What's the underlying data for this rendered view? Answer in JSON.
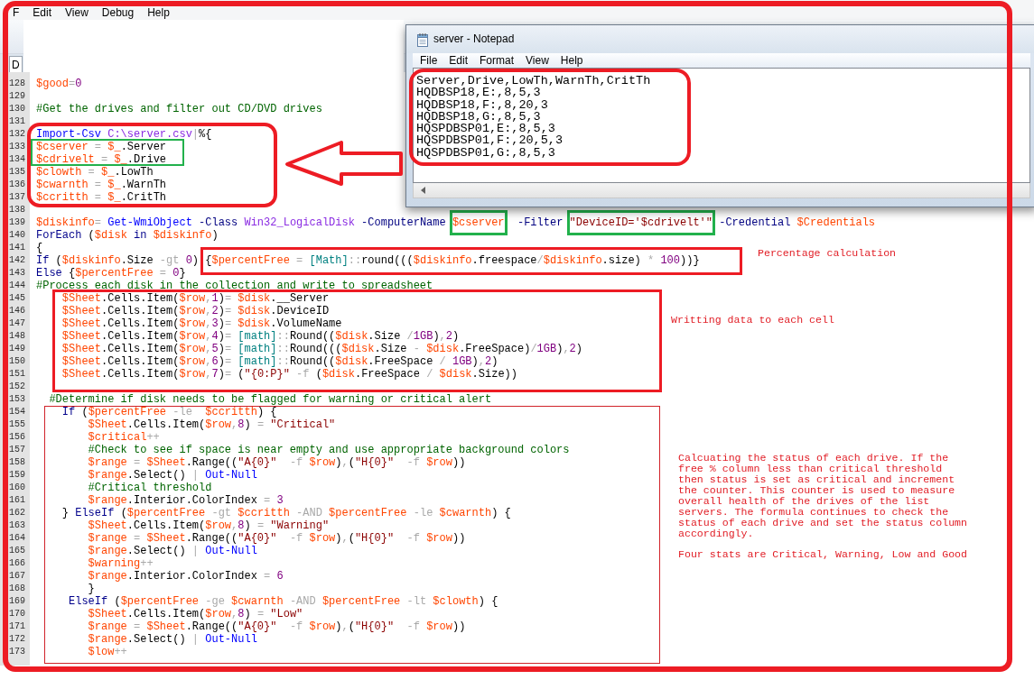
{
  "menu_bar": [
    "F",
    "Edit",
    "View",
    "Debug",
    "Help"
  ],
  "tabs": [
    {
      "label": "D",
      "selected": true
    }
  ],
  "editor": {
    "lines": [
      {
        "number": "128",
        "tokens": [
          {
            "kind": "var",
            "text": "$good"
          },
          {
            "kind": "op",
            "text": "="
          },
          {
            "kind": "num",
            "text": "0"
          }
        ]
      },
      {
        "number": "129"
      },
      {
        "number": "130",
        "tokens": [
          {
            "kind": "comment",
            "text": "#Get the drives and filter out CD/DVD drives"
          }
        ]
      },
      {
        "number": "131"
      },
      {
        "number": "132",
        "tokens": [
          {
            "kind": "cmd",
            "text": "Import-Csv"
          },
          {
            "kind": "arg",
            "text": " C:\\server.csv"
          },
          {
            "kind": "op",
            "text": "|"
          },
          {
            "kind": "text",
            "text": "%{"
          }
        ]
      },
      {
        "number": "133",
        "tokens": [
          {
            "kind": "var",
            "text": "$cserver"
          },
          {
            "kind": "op",
            "text": " = "
          },
          {
            "kind": "var",
            "text": "$_"
          },
          {
            "kind": "text",
            "text": ".Server"
          }
        ]
      },
      {
        "number": "134",
        "tokens": [
          {
            "kind": "var",
            "text": "$cdrivelt"
          },
          {
            "kind": "op",
            "text": " = "
          },
          {
            "kind": "var",
            "text": "$_"
          },
          {
            "kind": "text",
            "text": ".Drive"
          }
        ]
      },
      {
        "number": "135",
        "tokens": [
          {
            "kind": "var",
            "text": "$clowth"
          },
          {
            "kind": "op",
            "text": " = "
          },
          {
            "kind": "var",
            "text": "$_"
          },
          {
            "kind": "text",
            "text": ".LowTh"
          }
        ]
      },
      {
        "number": "136",
        "tokens": [
          {
            "kind": "var",
            "text": "$cwarnth"
          },
          {
            "kind": "op",
            "text": " = "
          },
          {
            "kind": "var",
            "text": "$_"
          },
          {
            "kind": "text",
            "text": ".WarnTh"
          }
        ]
      },
      {
        "number": "137",
        "tokens": [
          {
            "kind": "var",
            "text": "$ccritth"
          },
          {
            "kind": "op",
            "text": " = "
          },
          {
            "kind": "var",
            "text": "$_"
          },
          {
            "kind": "text",
            "text": ".CritTh"
          }
        ]
      },
      {
        "number": "138"
      },
      {
        "number": "139",
        "segments": [
          {
            "highlighted": false,
            "tokens": [
              {
                "kind": "var",
                "text": "$diskinfo"
              },
              {
                "kind": "op",
                "text": "= "
              },
              {
                "kind": "cmd",
                "text": "Get-WmiObject"
              },
              {
                "kind": "param",
                "text": " -Class"
              },
              {
                "kind": "arg",
                "text": " Win32_LogicalDisk"
              },
              {
                "kind": "param",
                "text": " -ComputerName"
              }
            ]
          },
          {
            "highlighted": true,
            "tokens": [
              {
                "kind": "var",
                "text": " $cserver"
              }
            ]
          },
          {
            "highlighted": false,
            "tokens": [
              {
                "kind": "param",
                "text": "  -Filter"
              }
            ]
          },
          {
            "highlighted": true,
            "tokens": [
              {
                "kind": "str",
                "text": " \"DeviceID='$cdrivelt'\""
              }
            ]
          },
          {
            "highlighted": false,
            "tokens": [
              {
                "kind": "param",
                "text": " -Credential"
              },
              {
                "kind": "var",
                "text": " $Credentials"
              }
            ]
          }
        ]
      },
      {
        "number": "140",
        "tokens": [
          {
            "kind": "kw",
            "text": "ForEach"
          },
          {
            "kind": "text",
            "text": " ("
          },
          {
            "kind": "var",
            "text": "$disk"
          },
          {
            "kind": "kw",
            "text": " in"
          },
          {
            "kind": "var",
            "text": " $diskinfo"
          },
          {
            "kind": "text",
            "text": ")"
          }
        ]
      },
      {
        "number": "141",
        "tokens": [
          {
            "kind": "text",
            "text": "{"
          }
        ]
      },
      {
        "number": "142",
        "tokens": [
          {
            "kind": "kw",
            "text": "If"
          },
          {
            "kind": "text",
            "text": " ("
          },
          {
            "kind": "var",
            "text": "$diskinfo"
          },
          {
            "kind": "text",
            "text": ".Size "
          },
          {
            "kind": "op",
            "text": "-gt"
          },
          {
            "kind": "num",
            "text": " 0"
          },
          {
            "kind": "text",
            "text": ") {"
          },
          {
            "kind": "var",
            "text": "$percentFree"
          },
          {
            "kind": "op",
            "text": " = "
          },
          {
            "kind": "type",
            "text": "[Math]"
          },
          {
            "kind": "op",
            "text": "::"
          },
          {
            "kind": "text",
            "text": "round((("
          },
          {
            "kind": "var",
            "text": "$diskinfo"
          },
          {
            "kind": "text",
            "text": ".freespace"
          },
          {
            "kind": "op",
            "text": "/"
          },
          {
            "kind": "var",
            "text": "$diskinfo"
          },
          {
            "kind": "text",
            "text": ".size) "
          },
          {
            "kind": "op",
            "text": "*"
          },
          {
            "kind": "num",
            "text": " 100"
          },
          {
            "kind": "text",
            "text": "))}"
          }
        ]
      },
      {
        "number": "143",
        "tokens": [
          {
            "kind": "kw",
            "text": "Else"
          },
          {
            "kind": "text",
            "text": " {"
          },
          {
            "kind": "var",
            "text": "$percentFree"
          },
          {
            "kind": "op",
            "text": " = "
          },
          {
            "kind": "num",
            "text": "0"
          },
          {
            "kind": "text",
            "text": "}"
          }
        ]
      },
      {
        "number": "144",
        "tokens": [
          {
            "kind": "comment",
            "text": "#Process each disk in the collection and write to spreadsheet"
          }
        ]
      },
      {
        "number": "145",
        "tokens": [
          {
            "kind": "var",
            "text": "    $Sheet"
          },
          {
            "kind": "text",
            "text": ".Cells.Item("
          },
          {
            "kind": "var",
            "text": "$row"
          },
          {
            "kind": "op",
            "text": ","
          },
          {
            "kind": "num",
            "text": "1"
          },
          {
            "kind": "text",
            "text": ")"
          },
          {
            "kind": "op",
            "text": "="
          },
          {
            "kind": "var",
            "text": " $disk"
          },
          {
            "kind": "text",
            "text": ".__Server"
          }
        ]
      },
      {
        "number": "146",
        "tokens": [
          {
            "kind": "var",
            "text": "    $Sheet"
          },
          {
            "kind": "text",
            "text": ".Cells.Item("
          },
          {
            "kind": "var",
            "text": "$row"
          },
          {
            "kind": "op",
            "text": ","
          },
          {
            "kind": "num",
            "text": "2"
          },
          {
            "kind": "text",
            "text": ")"
          },
          {
            "kind": "op",
            "text": "="
          },
          {
            "kind": "var",
            "text": " $disk"
          },
          {
            "kind": "text",
            "text": ".DeviceID"
          }
        ]
      },
      {
        "number": "147",
        "tokens": [
          {
            "kind": "var",
            "text": "    $Sheet"
          },
          {
            "kind": "text",
            "text": ".Cells.Item("
          },
          {
            "kind": "var",
            "text": "$row"
          },
          {
            "kind": "op",
            "text": ","
          },
          {
            "kind": "num",
            "text": "3"
          },
          {
            "kind": "text",
            "text": ")"
          },
          {
            "kind": "op",
            "text": "="
          },
          {
            "kind": "var",
            "text": " $disk"
          },
          {
            "kind": "text",
            "text": ".VolumeName"
          }
        ]
      },
      {
        "number": "148",
        "tokens": [
          {
            "kind": "var",
            "text": "    $Sheet"
          },
          {
            "kind": "text",
            "text": ".Cells.Item("
          },
          {
            "kind": "var",
            "text": "$row"
          },
          {
            "kind": "op",
            "text": ","
          },
          {
            "kind": "num",
            "text": "4"
          },
          {
            "kind": "text",
            "text": ")"
          },
          {
            "kind": "op",
            "text": "="
          },
          {
            "kind": "type",
            "text": " [math]"
          },
          {
            "kind": "op",
            "text": "::"
          },
          {
            "kind": "text",
            "text": "Round(("
          },
          {
            "kind": "var",
            "text": "$disk"
          },
          {
            "kind": "text",
            "text": ".Size "
          },
          {
            "kind": "op",
            "text": "/"
          },
          {
            "kind": "num",
            "text": "1GB"
          },
          {
            "kind": "text",
            "text": ")"
          },
          {
            "kind": "op",
            "text": ","
          },
          {
            "kind": "num",
            "text": "2"
          },
          {
            "kind": "text",
            "text": ")"
          }
        ]
      },
      {
        "number": "149",
        "tokens": [
          {
            "kind": "var",
            "text": "    $Sheet"
          },
          {
            "kind": "text",
            "text": ".Cells.Item("
          },
          {
            "kind": "var",
            "text": "$row"
          },
          {
            "kind": "op",
            "text": ","
          },
          {
            "kind": "num",
            "text": "5"
          },
          {
            "kind": "text",
            "text": ")"
          },
          {
            "kind": "op",
            "text": "="
          },
          {
            "kind": "type",
            "text": " [math]"
          },
          {
            "kind": "op",
            "text": "::"
          },
          {
            "kind": "text",
            "text": "Round((("
          },
          {
            "kind": "var",
            "text": "$disk"
          },
          {
            "kind": "text",
            "text": ".Size "
          },
          {
            "kind": "op",
            "text": "-"
          },
          {
            "kind": "var",
            "text": " $disk"
          },
          {
            "kind": "text",
            "text": ".FreeSpace)"
          },
          {
            "kind": "op",
            "text": "/"
          },
          {
            "kind": "num",
            "text": "1GB"
          },
          {
            "kind": "text",
            "text": ")"
          },
          {
            "kind": "op",
            "text": ","
          },
          {
            "kind": "num",
            "text": "2"
          },
          {
            "kind": "text",
            "text": ")"
          }
        ]
      },
      {
        "number": "150",
        "tokens": [
          {
            "kind": "var",
            "text": "    $Sheet"
          },
          {
            "kind": "text",
            "text": ".Cells.Item("
          },
          {
            "kind": "var",
            "text": "$row"
          },
          {
            "kind": "op",
            "text": ","
          },
          {
            "kind": "num",
            "text": "6"
          },
          {
            "kind": "text",
            "text": ")"
          },
          {
            "kind": "op",
            "text": "="
          },
          {
            "kind": "type",
            "text": " [math]"
          },
          {
            "kind": "op",
            "text": "::"
          },
          {
            "kind": "text",
            "text": "Round(("
          },
          {
            "kind": "var",
            "text": "$disk"
          },
          {
            "kind": "text",
            "text": ".FreeSpace "
          },
          {
            "kind": "op",
            "text": "/"
          },
          {
            "kind": "num",
            "text": " 1GB"
          },
          {
            "kind": "text",
            "text": ")"
          },
          {
            "kind": "op",
            "text": ","
          },
          {
            "kind": "num",
            "text": "2"
          },
          {
            "kind": "text",
            "text": ")"
          }
        ]
      },
      {
        "number": "151",
        "tokens": [
          {
            "kind": "var",
            "text": "    $Sheet"
          },
          {
            "kind": "text",
            "text": ".Cells.Item("
          },
          {
            "kind": "var",
            "text": "$row"
          },
          {
            "kind": "op",
            "text": ","
          },
          {
            "kind": "num",
            "text": "7"
          },
          {
            "kind": "text",
            "text": ")"
          },
          {
            "kind": "op",
            "text": "="
          },
          {
            "kind": "text",
            "text": " ("
          },
          {
            "kind": "str",
            "text": "\"{0:P}\""
          },
          {
            "kind": "op",
            "text": " -f"
          },
          {
            "kind": "text",
            "text": " ("
          },
          {
            "kind": "var",
            "text": "$disk"
          },
          {
            "kind": "text",
            "text": ".FreeSpace "
          },
          {
            "kind": "op",
            "text": "/"
          },
          {
            "kind": "var",
            "text": " $disk"
          },
          {
            "kind": "text",
            "text": ".Size))"
          }
        ]
      },
      {
        "number": "152"
      },
      {
        "number": "153",
        "tokens": [
          {
            "kind": "comment",
            "text": "  #Determine if disk needs to be flagged for warning or critical alert"
          }
        ]
      },
      {
        "number": "154",
        "tokens": [
          {
            "kind": "kw",
            "text": "    If"
          },
          {
            "kind": "text",
            "text": " ("
          },
          {
            "kind": "var",
            "text": "$percentFree"
          },
          {
            "kind": "op",
            "text": " -le"
          },
          {
            "kind": "var",
            "text": "  $ccritth"
          },
          {
            "kind": "text",
            "text": ") {"
          }
        ]
      },
      {
        "number": "155",
        "tokens": [
          {
            "kind": "var",
            "text": "        $Sheet"
          },
          {
            "kind": "text",
            "text": ".Cells.Item("
          },
          {
            "kind": "var",
            "text": "$row"
          },
          {
            "kind": "op",
            "text": ","
          },
          {
            "kind": "num",
            "text": "8"
          },
          {
            "kind": "text",
            "text": ") "
          },
          {
            "kind": "op",
            "text": "="
          },
          {
            "kind": "str",
            "text": " \"Critical\""
          }
        ]
      },
      {
        "number": "156",
        "tokens": [
          {
            "kind": "var",
            "text": "        $critical"
          },
          {
            "kind": "op",
            "text": "++"
          }
        ]
      },
      {
        "number": "157",
        "tokens": [
          {
            "kind": "comment",
            "text": "        #Check to see if space is near empty and use appropriate background colors"
          }
        ]
      },
      {
        "number": "158",
        "tokens": [
          {
            "kind": "var",
            "text": "        $range"
          },
          {
            "kind": "op",
            "text": " = "
          },
          {
            "kind": "var",
            "text": "$Sheet"
          },
          {
            "kind": "text",
            "text": ".Range(("
          },
          {
            "kind": "str",
            "text": "\"A{0}\""
          },
          {
            "kind": "op",
            "text": "  -f"
          },
          {
            "kind": "var",
            "text": " $row"
          },
          {
            "kind": "text",
            "text": ")"
          },
          {
            "kind": "op",
            "text": ","
          },
          {
            "kind": "text",
            "text": "("
          },
          {
            "kind": "str",
            "text": "\"H{0}\""
          },
          {
            "kind": "op",
            "text": "  -f"
          },
          {
            "kind": "var",
            "text": " $row"
          },
          {
            "kind": "text",
            "text": "))"
          }
        ]
      },
      {
        "number": "159",
        "tokens": [
          {
            "kind": "var",
            "text": "        $range"
          },
          {
            "kind": "text",
            "text": ".Select() "
          },
          {
            "kind": "op",
            "text": "|"
          },
          {
            "kind": "cmd",
            "text": " Out-Null"
          }
        ]
      },
      {
        "number": "160",
        "tokens": [
          {
            "kind": "comment",
            "text": "        #Critical threshold"
          }
        ]
      },
      {
        "number": "161",
        "tokens": [
          {
            "kind": "var",
            "text": "        $range"
          },
          {
            "kind": "text",
            "text": ".Interior.ColorIndex "
          },
          {
            "kind": "op",
            "text": "="
          },
          {
            "kind": "num",
            "text": " 3"
          }
        ]
      },
      {
        "number": "162",
        "tokens": [
          {
            "kind": "text",
            "text": "    } "
          },
          {
            "kind": "kw",
            "text": "ElseIf"
          },
          {
            "kind": "text",
            "text": " ("
          },
          {
            "kind": "var",
            "text": "$percentFree"
          },
          {
            "kind": "op",
            "text": " -gt"
          },
          {
            "kind": "var",
            "text": " $ccritth"
          },
          {
            "kind": "op",
            "text": " -AND"
          },
          {
            "kind": "var",
            "text": " $percentFree"
          },
          {
            "kind": "op",
            "text": " -le"
          },
          {
            "kind": "var",
            "text": " $cwarnth"
          },
          {
            "kind": "text",
            "text": ") {"
          }
        ]
      },
      {
        "number": "163",
        "tokens": [
          {
            "kind": "var",
            "text": "        $Sheet"
          },
          {
            "kind": "text",
            "text": ".Cells.Item("
          },
          {
            "kind": "var",
            "text": "$row"
          },
          {
            "kind": "op",
            "text": ","
          },
          {
            "kind": "num",
            "text": "8"
          },
          {
            "kind": "text",
            "text": ") "
          },
          {
            "kind": "op",
            "text": "="
          },
          {
            "kind": "str",
            "text": " \"Warning\""
          }
        ]
      },
      {
        "number": "164",
        "tokens": [
          {
            "kind": "var",
            "text": "        $range"
          },
          {
            "kind": "op",
            "text": " = "
          },
          {
            "kind": "var",
            "text": "$Sheet"
          },
          {
            "kind": "text",
            "text": ".Range(("
          },
          {
            "kind": "str",
            "text": "\"A{0}\""
          },
          {
            "kind": "op",
            "text": "  -f"
          },
          {
            "kind": "var",
            "text": " $row"
          },
          {
            "kind": "text",
            "text": ")"
          },
          {
            "kind": "op",
            "text": ","
          },
          {
            "kind": "text",
            "text": "("
          },
          {
            "kind": "str",
            "text": "\"H{0}\""
          },
          {
            "kind": "op",
            "text": "  -f"
          },
          {
            "kind": "var",
            "text": " $row"
          },
          {
            "kind": "text",
            "text": "))"
          }
        ]
      },
      {
        "number": "165",
        "tokens": [
          {
            "kind": "var",
            "text": "        $range"
          },
          {
            "kind": "text",
            "text": ".Select() "
          },
          {
            "kind": "op",
            "text": "|"
          },
          {
            "kind": "cmd",
            "text": " Out-Null"
          }
        ]
      },
      {
        "number": "166",
        "tokens": [
          {
            "kind": "var",
            "text": "        $warning"
          },
          {
            "kind": "op",
            "text": "++"
          }
        ]
      },
      {
        "number": "167",
        "tokens": [
          {
            "kind": "var",
            "text": "        $range"
          },
          {
            "kind": "text",
            "text": ".Interior.ColorIndex "
          },
          {
            "kind": "op",
            "text": "="
          },
          {
            "kind": "num",
            "text": " 6"
          }
        ]
      },
      {
        "number": "168",
        "tokens": [
          {
            "kind": "text",
            "text": "        }"
          }
        ]
      },
      {
        "number": "169",
        "tokens": [
          {
            "kind": "kw",
            "text": "     ElseIf"
          },
          {
            "kind": "text",
            "text": " ("
          },
          {
            "kind": "var",
            "text": "$percentFree"
          },
          {
            "kind": "op",
            "text": " -ge"
          },
          {
            "kind": "var",
            "text": " $cwarnth"
          },
          {
            "kind": "op",
            "text": " -AND"
          },
          {
            "kind": "var",
            "text": " $percentFree"
          },
          {
            "kind": "op",
            "text": " -lt"
          },
          {
            "kind": "var",
            "text": " $clowth"
          },
          {
            "kind": "text",
            "text": ") {"
          }
        ]
      },
      {
        "number": "170",
        "tokens": [
          {
            "kind": "var",
            "text": "        $Sheet"
          },
          {
            "kind": "text",
            "text": ".Cells.Item("
          },
          {
            "kind": "var",
            "text": "$row"
          },
          {
            "kind": "op",
            "text": ","
          },
          {
            "kind": "num",
            "text": "8"
          },
          {
            "kind": "text",
            "text": ") "
          },
          {
            "kind": "op",
            "text": "="
          },
          {
            "kind": "str",
            "text": " \"Low\""
          }
        ]
      },
      {
        "number": "171",
        "tokens": [
          {
            "kind": "var",
            "text": "        $range"
          },
          {
            "kind": "op",
            "text": " = "
          },
          {
            "kind": "var",
            "text": "$Sheet"
          },
          {
            "kind": "text",
            "text": ".Range(("
          },
          {
            "kind": "str",
            "text": "\"A{0}\""
          },
          {
            "kind": "op",
            "text": "  -f"
          },
          {
            "kind": "var",
            "text": " $row"
          },
          {
            "kind": "text",
            "text": ")"
          },
          {
            "kind": "op",
            "text": ","
          },
          {
            "kind": "text",
            "text": "("
          },
          {
            "kind": "str",
            "text": "\"H{0}\""
          },
          {
            "kind": "op",
            "text": "  -f"
          },
          {
            "kind": "var",
            "text": " $row"
          },
          {
            "kind": "text",
            "text": "))"
          }
        ]
      },
      {
        "number": "172",
        "tokens": [
          {
            "kind": "var",
            "text": "        $range"
          },
          {
            "kind": "text",
            "text": ".Select() "
          },
          {
            "kind": "op",
            "text": "|"
          },
          {
            "kind": "cmd",
            "text": " Out-Null"
          }
        ]
      },
      {
        "number": "173",
        "tokens": [
          {
            "kind": "var",
            "text": "        $low"
          },
          {
            "kind": "op",
            "text": "++"
          }
        ]
      }
    ]
  },
  "notepad": {
    "title": "server - Notepad",
    "menu": [
      "File",
      "Edit",
      "Format",
      "View",
      "Help"
    ],
    "lines": [
      "Server,Drive,LowTh,WarnTh,CritTh",
      "HQDBSP18,E:,8,5,3",
      "HQDBSP18,F:,8,20,3",
      "HQDBSP18,G:,8,5,3",
      "HQSPDBSP01,E:,8,5,3",
      "HQSPDBSP01,F:,20,5,3",
      "HQSPDBSP01,G:,8,5,3"
    ]
  },
  "annotations": {
    "notes": [
      "Percentage calculation",
      "Writting data to each cell",
      "Calcuating the status of each drive. If the free % column less than critical threshold then status is set as critical and increment the counter. This counter is used to measure overall health of the drives of the list servers. The formula continues to check the status of each drive and set the status column accordingly.",
      "Four stats are Critical, Warning, Low and Good"
    ]
  }
}
